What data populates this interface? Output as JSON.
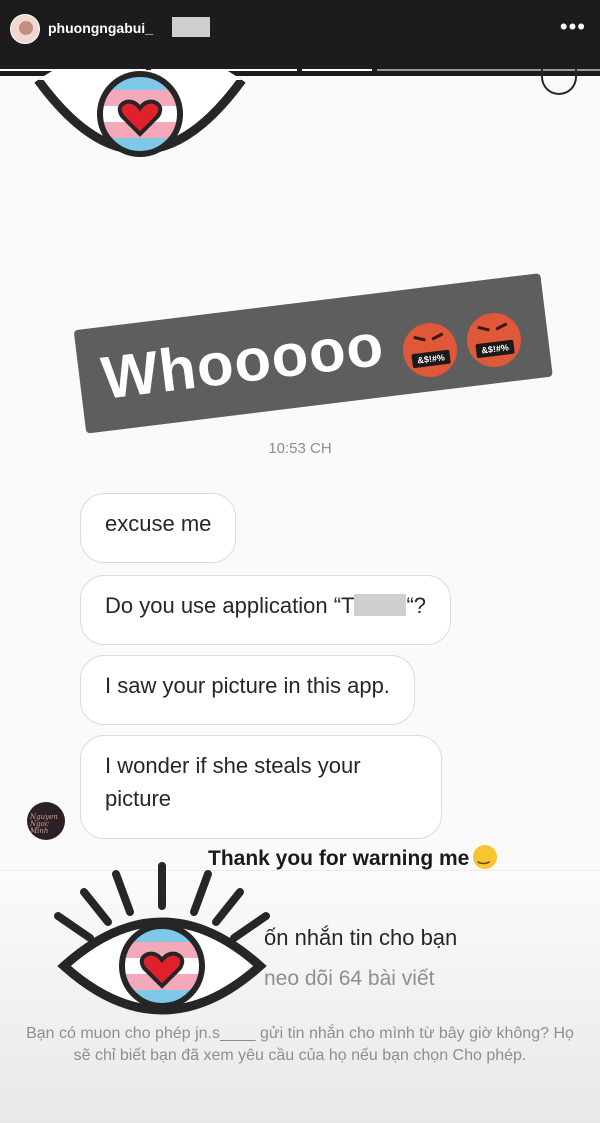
{
  "header": {
    "username": "phuongngabui_",
    "more_label": "•••"
  },
  "story": {
    "segments": 4,
    "current_segment": 3
  },
  "chat": {
    "sticker_text": "Whooooo",
    "sticker_emoji_label": "&$!#%",
    "timestamp": "10:53 CH",
    "messages": [
      {
        "text": "excuse me"
      },
      {
        "text_before": "Do you use application “T",
        "text_after": "“?"
      },
      {
        "text": "I saw your picture in this app."
      },
      {
        "text": "I wonder if she steals your picture"
      }
    ],
    "sender_avatar_text": "Nguyen Ngoc Minh"
  },
  "overlay": {
    "caption": "Thank you for warning me"
  },
  "request": {
    "title": "ốn nhắn tin cho bạn",
    "subtitle": "neo dõi 64 bài viết",
    "description": "Bạn có muon cho phép jn.s____ gửi tin nhắn cho mình từ bây giờ không? Họ sẽ chỉ biết bạn đã xem yêu cầu của họ nếu bạn chọn Cho phép."
  },
  "colors": {
    "header_bg": "#1c1c1c",
    "sticker_bg": "#5e5e5e",
    "angry_emoji": "#e0573a",
    "flag_blue": "#7fc8e8",
    "flag_pink": "#f3a9b9",
    "heart_red": "#e0202a"
  },
  "icons": [
    "more-icon",
    "info-icon",
    "eye-sticker-icon",
    "angry-emoji-icon",
    "smile-emoji-icon"
  ]
}
